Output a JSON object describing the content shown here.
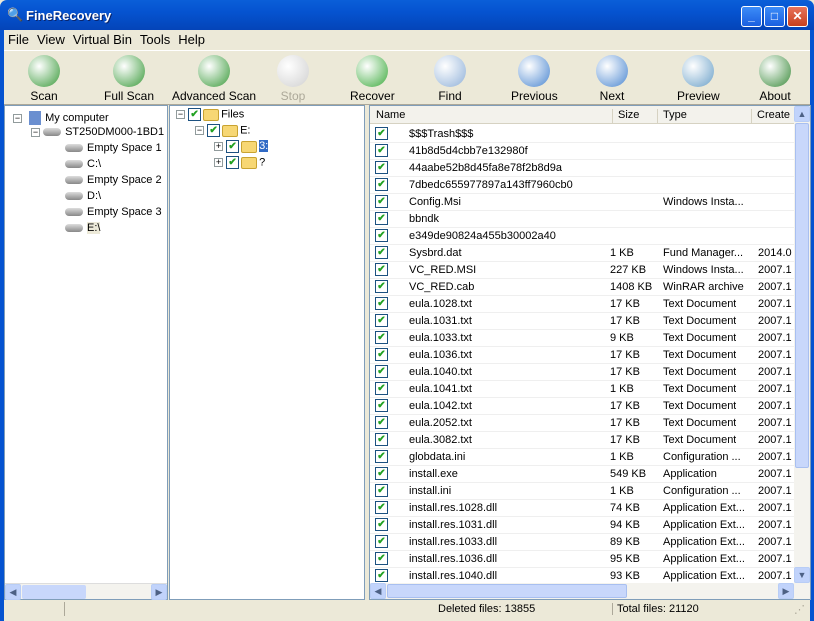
{
  "window": {
    "title": "FineRecovery"
  },
  "menu": [
    "File",
    "View",
    "Virtual Bin",
    "Tools",
    "Help"
  ],
  "toolbar": [
    {
      "label": "Scan",
      "icon": "scan-icon",
      "color": "#3a9a3a"
    },
    {
      "label": "Full Scan",
      "icon": "full-scan-icon",
      "color": "#3a9a3a"
    },
    {
      "label": "Advanced Scan",
      "icon": "advanced-scan-icon",
      "color": "#3a9a3a"
    },
    {
      "label": "Stop",
      "icon": "stop-icon",
      "color": "#d0d0d0",
      "disabled": true
    },
    {
      "label": "Recover",
      "icon": "floppy-disk-icon",
      "color": "#3caa3c"
    },
    {
      "label": "Find",
      "icon": "magnifier-icon",
      "color": "#8fb0d8"
    },
    {
      "label": "Previous",
      "icon": "previous-magnifier-icon",
      "color": "#4a86d0"
    },
    {
      "label": "Next",
      "icon": "next-magnifier-icon",
      "color": "#4a86d0"
    },
    {
      "label": "Preview",
      "icon": "preview-eye-icon",
      "color": "#6aa0c8"
    },
    {
      "label": "About",
      "icon": "globe-icon",
      "color": "#3a8a3a"
    }
  ],
  "drives": {
    "root": "My computer",
    "disk": "ST250DM000-1BD1",
    "items": [
      "Empty Space 1",
      "C:\\",
      "Empty Space 2",
      "D:\\",
      "Empty Space 3",
      "E:\\"
    ],
    "selected": "E:\\"
  },
  "folders": {
    "root": "Files",
    "drive": "E:",
    "children": [
      "3:",
      "?"
    ],
    "selected": "3:"
  },
  "files": {
    "columns": [
      "Name",
      "Size",
      "Type",
      "Create"
    ],
    "rows": [
      [
        "$$$Trash$$$",
        "",
        "",
        "",
        "folder"
      ],
      [
        "41b8d5d4cbb7e132980f",
        "",
        "",
        "",
        "folder"
      ],
      [
        "44aabe52b8d45fa8e78f2b8d9a",
        "",
        "",
        "",
        "folder"
      ],
      [
        "7dbedc655977897a143ff7960cb0",
        "",
        "",
        "",
        "folder"
      ],
      [
        "Config.Msi",
        "",
        "Windows Insta...",
        "",
        "folder"
      ],
      [
        "bbndk",
        "",
        "",
        "",
        "folder"
      ],
      [
        "e349de90824a455b30002a40",
        "",
        "",
        "",
        "folder"
      ],
      [
        "Sysbrd.dat",
        "1 KB",
        "Fund Manager...",
        "2014.0",
        "dat"
      ],
      [
        "VC_RED.MSI",
        "227 KB",
        "Windows Insta...",
        "2007.1",
        "msi"
      ],
      [
        "VC_RED.cab",
        "1408 KB",
        "WinRAR archive",
        "2007.1",
        "rar"
      ],
      [
        "eula.1028.txt",
        "17 KB",
        "Text Document",
        "2007.1",
        "txt"
      ],
      [
        "eula.1031.txt",
        "17 KB",
        "Text Document",
        "2007.1",
        "txt"
      ],
      [
        "eula.1033.txt",
        "9 KB",
        "Text Document",
        "2007.1",
        "txt"
      ],
      [
        "eula.1036.txt",
        "17 KB",
        "Text Document",
        "2007.1",
        "txt"
      ],
      [
        "eula.1040.txt",
        "17 KB",
        "Text Document",
        "2007.1",
        "txt"
      ],
      [
        "eula.1041.txt",
        "1 KB",
        "Text Document",
        "2007.1",
        "txt"
      ],
      [
        "eula.1042.txt",
        "17 KB",
        "Text Document",
        "2007.1",
        "txt"
      ],
      [
        "eula.2052.txt",
        "17 KB",
        "Text Document",
        "2007.1",
        "txt"
      ],
      [
        "eula.3082.txt",
        "17 KB",
        "Text Document",
        "2007.1",
        "txt"
      ],
      [
        "globdata.ini",
        "1 KB",
        "Configuration ...",
        "2007.1",
        "ini"
      ],
      [
        "install.exe",
        "549 KB",
        "Application",
        "2007.1",
        "exe"
      ],
      [
        "install.ini",
        "1 KB",
        "Configuration ...",
        "2007.1",
        "ini"
      ],
      [
        "install.res.1028.dll",
        "74 KB",
        "Application Ext...",
        "2007.1",
        "dll"
      ],
      [
        "install.res.1031.dll",
        "94 KB",
        "Application Ext...",
        "2007.1",
        "dll"
      ],
      [
        "install.res.1033.dll",
        "89 KB",
        "Application Ext...",
        "2007.1",
        "dll"
      ],
      [
        "install.res.1036.dll",
        "95 KB",
        "Application Ext...",
        "2007.1",
        "dll"
      ],
      [
        "install.res.1040.dll",
        "93 KB",
        "Application Ext...",
        "2007.1",
        "dll"
      ]
    ]
  },
  "status": {
    "deleted": "Deleted files: 13855",
    "total": "Total files: 21120"
  }
}
